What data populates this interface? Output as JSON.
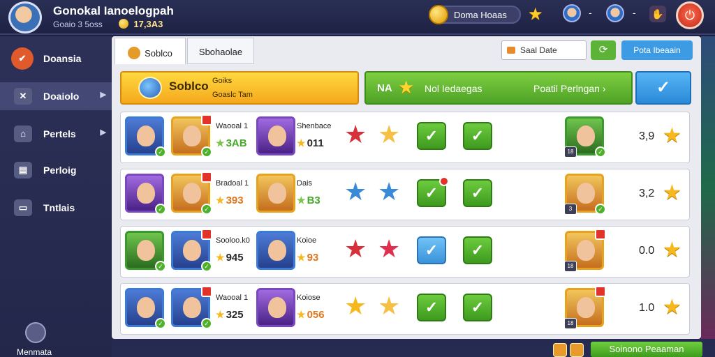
{
  "header": {
    "title": "Gonokal Ianoelogpah",
    "subtitle": "Goaio 3 5oss",
    "coins": "17,3A3",
    "currency_text": "Doma Hoaas",
    "separators": [
      "-",
      "-"
    ],
    "bell_glyph": "✋",
    "power_glyph": "⏻"
  },
  "sidebar": {
    "items": [
      {
        "label": "Doansia",
        "icon": "badge-icon"
      },
      {
        "label": "Doaiolo",
        "icon": "swords-icon",
        "active": true,
        "arrow": "▶"
      },
      {
        "label": "Pertels",
        "icon": "house-icon",
        "arrow": "▶"
      },
      {
        "label": "Perloig",
        "icon": "chart-icon"
      },
      {
        "label": "Tntlais",
        "icon": "monitor-icon"
      }
    ],
    "footer_label": "Menmata"
  },
  "tabs": [
    {
      "label": "Soblco",
      "active": true
    },
    {
      "label": "Sbohaolae"
    }
  ],
  "toolbar": {
    "date_placeholder": "Saal Date",
    "refresh_glyph": "⟳",
    "primary_label": "Pota Ibeaain"
  },
  "banners": {
    "yellow": {
      "title": "Soblco",
      "sub_a": "Goiks",
      "sub_b": "Goaslc Tam"
    },
    "green": {
      "prefix": "NA",
      "middle": "Nol Iedaegas",
      "right": "Poatil Perlngan",
      "arrow": "›"
    },
    "check_glyph": "✓"
  },
  "rows": [
    {
      "hero1": "blue",
      "hero2": "gold",
      "name1": "Waooal 1",
      "score1": "3AB",
      "score1_color": "green",
      "hero3": "purple",
      "name2": "Shenbace",
      "score2": "011",
      "star1": "#d8303a",
      "star2": "#f5c043",
      "toggle": "green",
      "toggle_dot": false,
      "portrait": "green",
      "rating": "3,9"
    },
    {
      "hero1": "purple",
      "hero2": "gold",
      "name1": "Bradoal 1",
      "score1": "393",
      "score1_color": "orange",
      "hero3": "gold",
      "name2": "Dais",
      "score2": "B3",
      "score2_color": "green",
      "star1": "#3a8ad8",
      "star2": "#3a8ad8",
      "toggle": "green",
      "toggle_dot": true,
      "portrait": "gold",
      "rating": "3,2"
    },
    {
      "hero1": "green",
      "hero2": "blue",
      "name1": "Sooloo.k0",
      "score1": "945",
      "hero3": "blue",
      "name2": "Koioe",
      "score2": "93",
      "score2_color": "orange",
      "star1": "#d8303a",
      "star2": "#e0304f",
      "toggle": "blue",
      "toggle_dot": false,
      "portrait": "gold",
      "rating": "0.0"
    },
    {
      "hero1": "blue",
      "hero2": "blue",
      "name1": "Waooal 1",
      "score1": "325",
      "hero3": "purple",
      "name2": "Koiose",
      "score2": "056",
      "score2_color": "orange",
      "star1": "#f5b81d",
      "star2": "#f5c043",
      "toggle": "green",
      "toggle_dot": false,
      "portrait": "gold",
      "rating": "1.0"
    }
  ],
  "footer": {
    "button_label": "Soinono Peaaman"
  },
  "colors": {
    "accent_green": "#4ea226",
    "accent_yellow": "#f5a81c",
    "accent_blue": "#2b8ad8",
    "star_gold": "#f7b81d"
  }
}
